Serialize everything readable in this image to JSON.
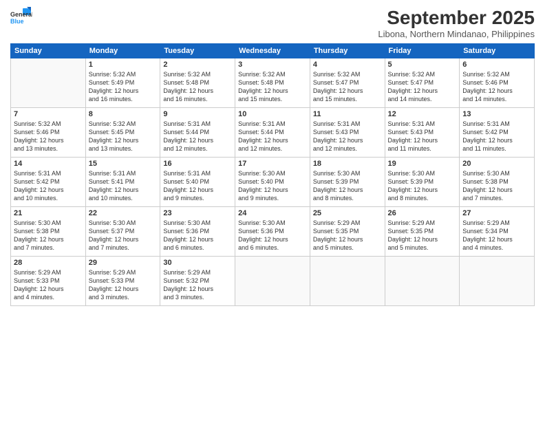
{
  "logo": {
    "line1": "General",
    "line2": "Blue"
  },
  "title": "September 2025",
  "location": "Libona, Northern Mindanao, Philippines",
  "days": [
    "Sunday",
    "Monday",
    "Tuesday",
    "Wednesday",
    "Thursday",
    "Friday",
    "Saturday"
  ],
  "weeks": [
    [
      {
        "day": "",
        "text": ""
      },
      {
        "day": "1",
        "text": "Sunrise: 5:32 AM\nSunset: 5:49 PM\nDaylight: 12 hours\nand 16 minutes."
      },
      {
        "day": "2",
        "text": "Sunrise: 5:32 AM\nSunset: 5:48 PM\nDaylight: 12 hours\nand 16 minutes."
      },
      {
        "day": "3",
        "text": "Sunrise: 5:32 AM\nSunset: 5:48 PM\nDaylight: 12 hours\nand 15 minutes."
      },
      {
        "day": "4",
        "text": "Sunrise: 5:32 AM\nSunset: 5:47 PM\nDaylight: 12 hours\nand 15 minutes."
      },
      {
        "day": "5",
        "text": "Sunrise: 5:32 AM\nSunset: 5:47 PM\nDaylight: 12 hours\nand 14 minutes."
      },
      {
        "day": "6",
        "text": "Sunrise: 5:32 AM\nSunset: 5:46 PM\nDaylight: 12 hours\nand 14 minutes."
      }
    ],
    [
      {
        "day": "7",
        "text": "Sunrise: 5:32 AM\nSunset: 5:46 PM\nDaylight: 12 hours\nand 13 minutes."
      },
      {
        "day": "8",
        "text": "Sunrise: 5:32 AM\nSunset: 5:45 PM\nDaylight: 12 hours\nand 13 minutes."
      },
      {
        "day": "9",
        "text": "Sunrise: 5:31 AM\nSunset: 5:44 PM\nDaylight: 12 hours\nand 12 minutes."
      },
      {
        "day": "10",
        "text": "Sunrise: 5:31 AM\nSunset: 5:44 PM\nDaylight: 12 hours\nand 12 minutes."
      },
      {
        "day": "11",
        "text": "Sunrise: 5:31 AM\nSunset: 5:43 PM\nDaylight: 12 hours\nand 12 minutes."
      },
      {
        "day": "12",
        "text": "Sunrise: 5:31 AM\nSunset: 5:43 PM\nDaylight: 12 hours\nand 11 minutes."
      },
      {
        "day": "13",
        "text": "Sunrise: 5:31 AM\nSunset: 5:42 PM\nDaylight: 12 hours\nand 11 minutes."
      }
    ],
    [
      {
        "day": "14",
        "text": "Sunrise: 5:31 AM\nSunset: 5:42 PM\nDaylight: 12 hours\nand 10 minutes."
      },
      {
        "day": "15",
        "text": "Sunrise: 5:31 AM\nSunset: 5:41 PM\nDaylight: 12 hours\nand 10 minutes."
      },
      {
        "day": "16",
        "text": "Sunrise: 5:31 AM\nSunset: 5:40 PM\nDaylight: 12 hours\nand 9 minutes."
      },
      {
        "day": "17",
        "text": "Sunrise: 5:30 AM\nSunset: 5:40 PM\nDaylight: 12 hours\nand 9 minutes."
      },
      {
        "day": "18",
        "text": "Sunrise: 5:30 AM\nSunset: 5:39 PM\nDaylight: 12 hours\nand 8 minutes."
      },
      {
        "day": "19",
        "text": "Sunrise: 5:30 AM\nSunset: 5:39 PM\nDaylight: 12 hours\nand 8 minutes."
      },
      {
        "day": "20",
        "text": "Sunrise: 5:30 AM\nSunset: 5:38 PM\nDaylight: 12 hours\nand 7 minutes."
      }
    ],
    [
      {
        "day": "21",
        "text": "Sunrise: 5:30 AM\nSunset: 5:38 PM\nDaylight: 12 hours\nand 7 minutes."
      },
      {
        "day": "22",
        "text": "Sunrise: 5:30 AM\nSunset: 5:37 PM\nDaylight: 12 hours\nand 7 minutes."
      },
      {
        "day": "23",
        "text": "Sunrise: 5:30 AM\nSunset: 5:36 PM\nDaylight: 12 hours\nand 6 minutes."
      },
      {
        "day": "24",
        "text": "Sunrise: 5:30 AM\nSunset: 5:36 PM\nDaylight: 12 hours\nand 6 minutes."
      },
      {
        "day": "25",
        "text": "Sunrise: 5:29 AM\nSunset: 5:35 PM\nDaylight: 12 hours\nand 5 minutes."
      },
      {
        "day": "26",
        "text": "Sunrise: 5:29 AM\nSunset: 5:35 PM\nDaylight: 12 hours\nand 5 minutes."
      },
      {
        "day": "27",
        "text": "Sunrise: 5:29 AM\nSunset: 5:34 PM\nDaylight: 12 hours\nand 4 minutes."
      }
    ],
    [
      {
        "day": "28",
        "text": "Sunrise: 5:29 AM\nSunset: 5:33 PM\nDaylight: 12 hours\nand 4 minutes."
      },
      {
        "day": "29",
        "text": "Sunrise: 5:29 AM\nSunset: 5:33 PM\nDaylight: 12 hours\nand 3 minutes."
      },
      {
        "day": "30",
        "text": "Sunrise: 5:29 AM\nSunset: 5:32 PM\nDaylight: 12 hours\nand 3 minutes."
      },
      {
        "day": "",
        "text": ""
      },
      {
        "day": "",
        "text": ""
      },
      {
        "day": "",
        "text": ""
      },
      {
        "day": "",
        "text": ""
      }
    ]
  ]
}
